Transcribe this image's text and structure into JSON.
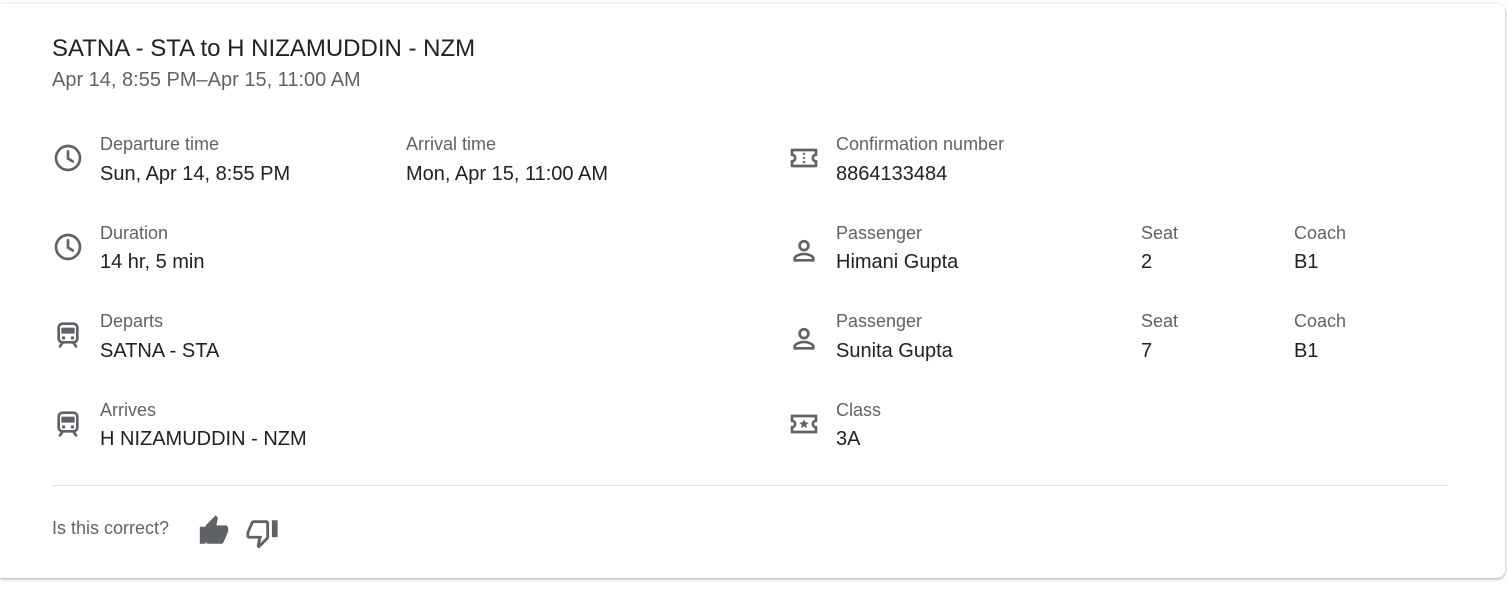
{
  "trip": {
    "title": "SATNA - STA to H NIZAMUDDIN - NZM",
    "date_range": "Apr 14, 8:55 PM–Apr 15, 11:00 AM"
  },
  "departure_time": {
    "label": "Departure time",
    "value": "Sun, Apr 14, 8:55 PM",
    "icon": "clock-icon"
  },
  "arrival_time": {
    "label": "Arrival time",
    "value": "Mon, Apr 15, 11:00 AM"
  },
  "duration": {
    "label": "Duration",
    "value": "14 hr, 5 min",
    "icon": "clock-icon"
  },
  "departs": {
    "label": "Departs",
    "value": "SATNA - STA",
    "icon": "train-icon"
  },
  "arrives": {
    "label": "Arrives",
    "value": "H NIZAMUDDIN - NZM",
    "icon": "train-icon"
  },
  "confirmation": {
    "label": "Confirmation number",
    "value": "8864133484",
    "icon": "ticket-icon"
  },
  "passengers": [
    {
      "label": "Passenger",
      "name": "Himani Gupta",
      "seat_label": "Seat",
      "seat": "2",
      "coach_label": "Coach",
      "coach": "B1",
      "icon": "person-icon"
    },
    {
      "label": "Passenger",
      "name": "Sunita Gupta",
      "seat_label": "Seat",
      "seat": "7",
      "coach_label": "Coach",
      "coach": "B1",
      "icon": "person-icon"
    }
  ],
  "travel_class": {
    "label": "Class",
    "value": "3A",
    "icon": "ticket-star-icon"
  },
  "feedback": {
    "prompt": "Is this correct?",
    "thumbs_up_icon": "thumbs-up-icon",
    "thumbs_down_icon": "thumbs-down-icon"
  },
  "colors": {
    "icon": "#5f6368",
    "label": "#5f6368",
    "value": "#202124"
  }
}
